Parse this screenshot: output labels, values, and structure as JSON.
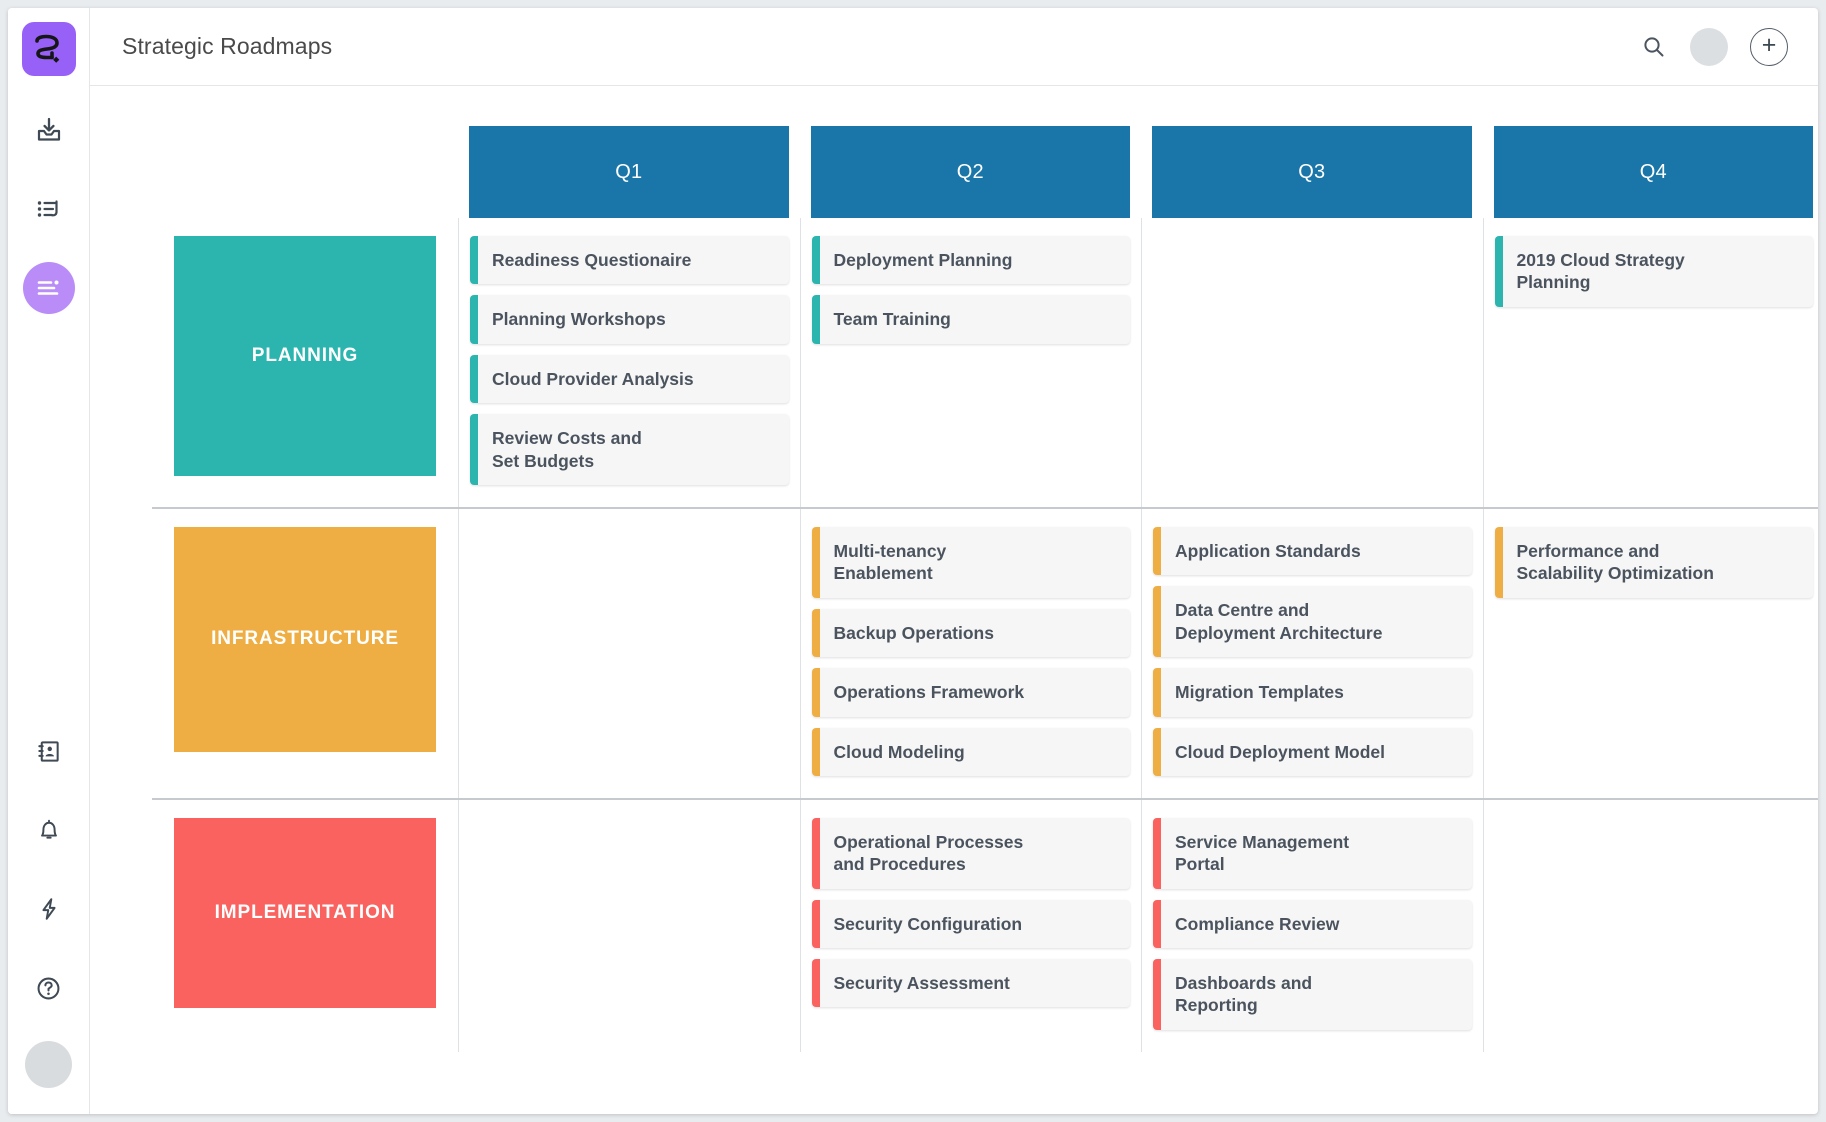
{
  "app": {
    "title": "Strategic Roadmaps"
  },
  "colors": {
    "brand_purple": "#9761f7",
    "rail_active": "#b98cf7",
    "quarter_header_blue": "#1a76a8",
    "lane_planning": "#2cb5af",
    "lane_infrastructure": "#efae44",
    "lane_implementation": "#f9625f",
    "card_background": "#f6f6f6",
    "card_text": "#4b545e"
  },
  "rail": {
    "logo_icon": "app-logo-icon",
    "items": [
      {
        "icon": "inbox-download-icon",
        "label": "Inbox",
        "active": false
      },
      {
        "icon": "list-reply-icon",
        "label": "Activity",
        "active": false
      },
      {
        "icon": "roadmap-lines-icon",
        "label": "Roadmaps",
        "active": true
      }
    ],
    "bottom_items": [
      {
        "icon": "contact-book-icon",
        "label": "Contacts"
      },
      {
        "icon": "bell-icon",
        "label": "Notifications"
      },
      {
        "icon": "lightning-icon",
        "label": "Automations"
      },
      {
        "icon": "help-circle-icon",
        "label": "Help"
      }
    ],
    "avatar": "user-avatar"
  },
  "topbar": {
    "search_icon": "search-icon",
    "avatar": "user-avatar",
    "add_label": "+"
  },
  "board": {
    "columns": [
      {
        "label": "Q1"
      },
      {
        "label": "Q2"
      },
      {
        "label": "Q3"
      },
      {
        "label": "Q4"
      }
    ],
    "lanes": [
      {
        "label": "PLANNING",
        "color": "#2cb5af",
        "cells": [
          [
            {
              "title": "Readiness  Questionaire",
              "multiline": false
            },
            {
              "title": "Planning Workshops",
              "multiline": false
            },
            {
              "title": "Cloud Provider Analysis",
              "multiline": false
            },
            {
              "title": "Review Costs and\nSet Budgets",
              "multiline": true
            }
          ],
          [
            {
              "title": "Deployment Planning",
              "multiline": false
            },
            {
              "title": "Team Training",
              "multiline": false
            }
          ],
          [],
          [
            {
              "title": "2019 Cloud Strategy\nPlanning",
              "multiline": true
            }
          ]
        ]
      },
      {
        "label": "INFRASTRUCTURE",
        "color": "#efae44",
        "cells": [
          [],
          [
            {
              "title": "Multi-tenancy\nEnablement",
              "multiline": true
            },
            {
              "title": "Backup Operations",
              "multiline": false
            },
            {
              "title": "Operations Framework",
              "multiline": false
            },
            {
              "title": "Cloud Modeling",
              "multiline": false
            }
          ],
          [
            {
              "title": "Application Standards",
              "multiline": false
            },
            {
              "title": "Data Centre and\nDeployment Architecture",
              "multiline": true
            },
            {
              "title": "Migration Templates",
              "multiline": false
            },
            {
              "title": "Cloud Deployment Model",
              "multiline": false
            }
          ],
          [
            {
              "title": "Performance and\nScalability Optimization",
              "multiline": true
            }
          ]
        ]
      },
      {
        "label": "IMPLEMENTATION",
        "color": "#f9625f",
        "cells": [
          [],
          [
            {
              "title": "Operational Processes\nand Procedures",
              "multiline": true
            },
            {
              "title": "Security Configuration",
              "multiline": false
            },
            {
              "title": "Security Assessment",
              "multiline": false
            }
          ],
          [
            {
              "title": "Service Management\nPortal",
              "multiline": true
            },
            {
              "title": "Compliance Review",
              "multiline": false
            },
            {
              "title": "Dashboards and\nReporting",
              "multiline": true
            }
          ],
          []
        ]
      }
    ]
  }
}
